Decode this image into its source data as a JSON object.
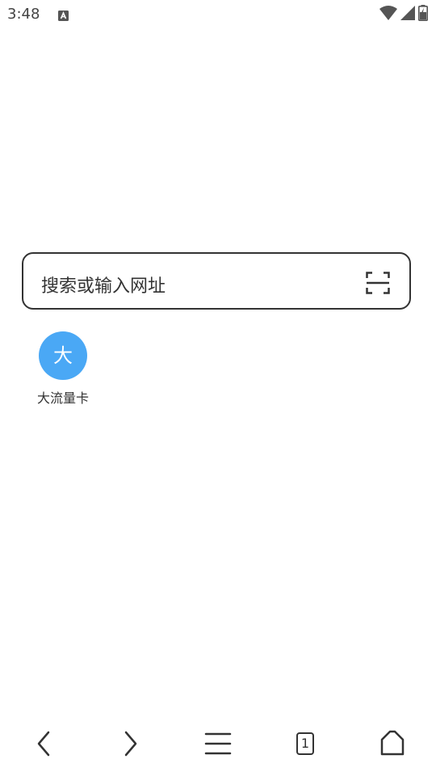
{
  "status_bar": {
    "time": "3:48",
    "notification_icon": "a-notification-icon",
    "wifi_icon": "wifi-icon",
    "signal_icon": "signal-icon",
    "battery_icon": "battery-charging-icon"
  },
  "search": {
    "placeholder": "搜索或输入网址",
    "scan_icon": "scan-icon"
  },
  "quick_links": [
    {
      "icon_text": "大",
      "label": "大流量卡",
      "color": "#4aa8f5"
    }
  ],
  "bottom_nav": {
    "back_icon": "back-icon",
    "forward_icon": "forward-icon",
    "menu_icon": "menu-icon",
    "tab_count": "1",
    "home_icon": "home-icon"
  }
}
